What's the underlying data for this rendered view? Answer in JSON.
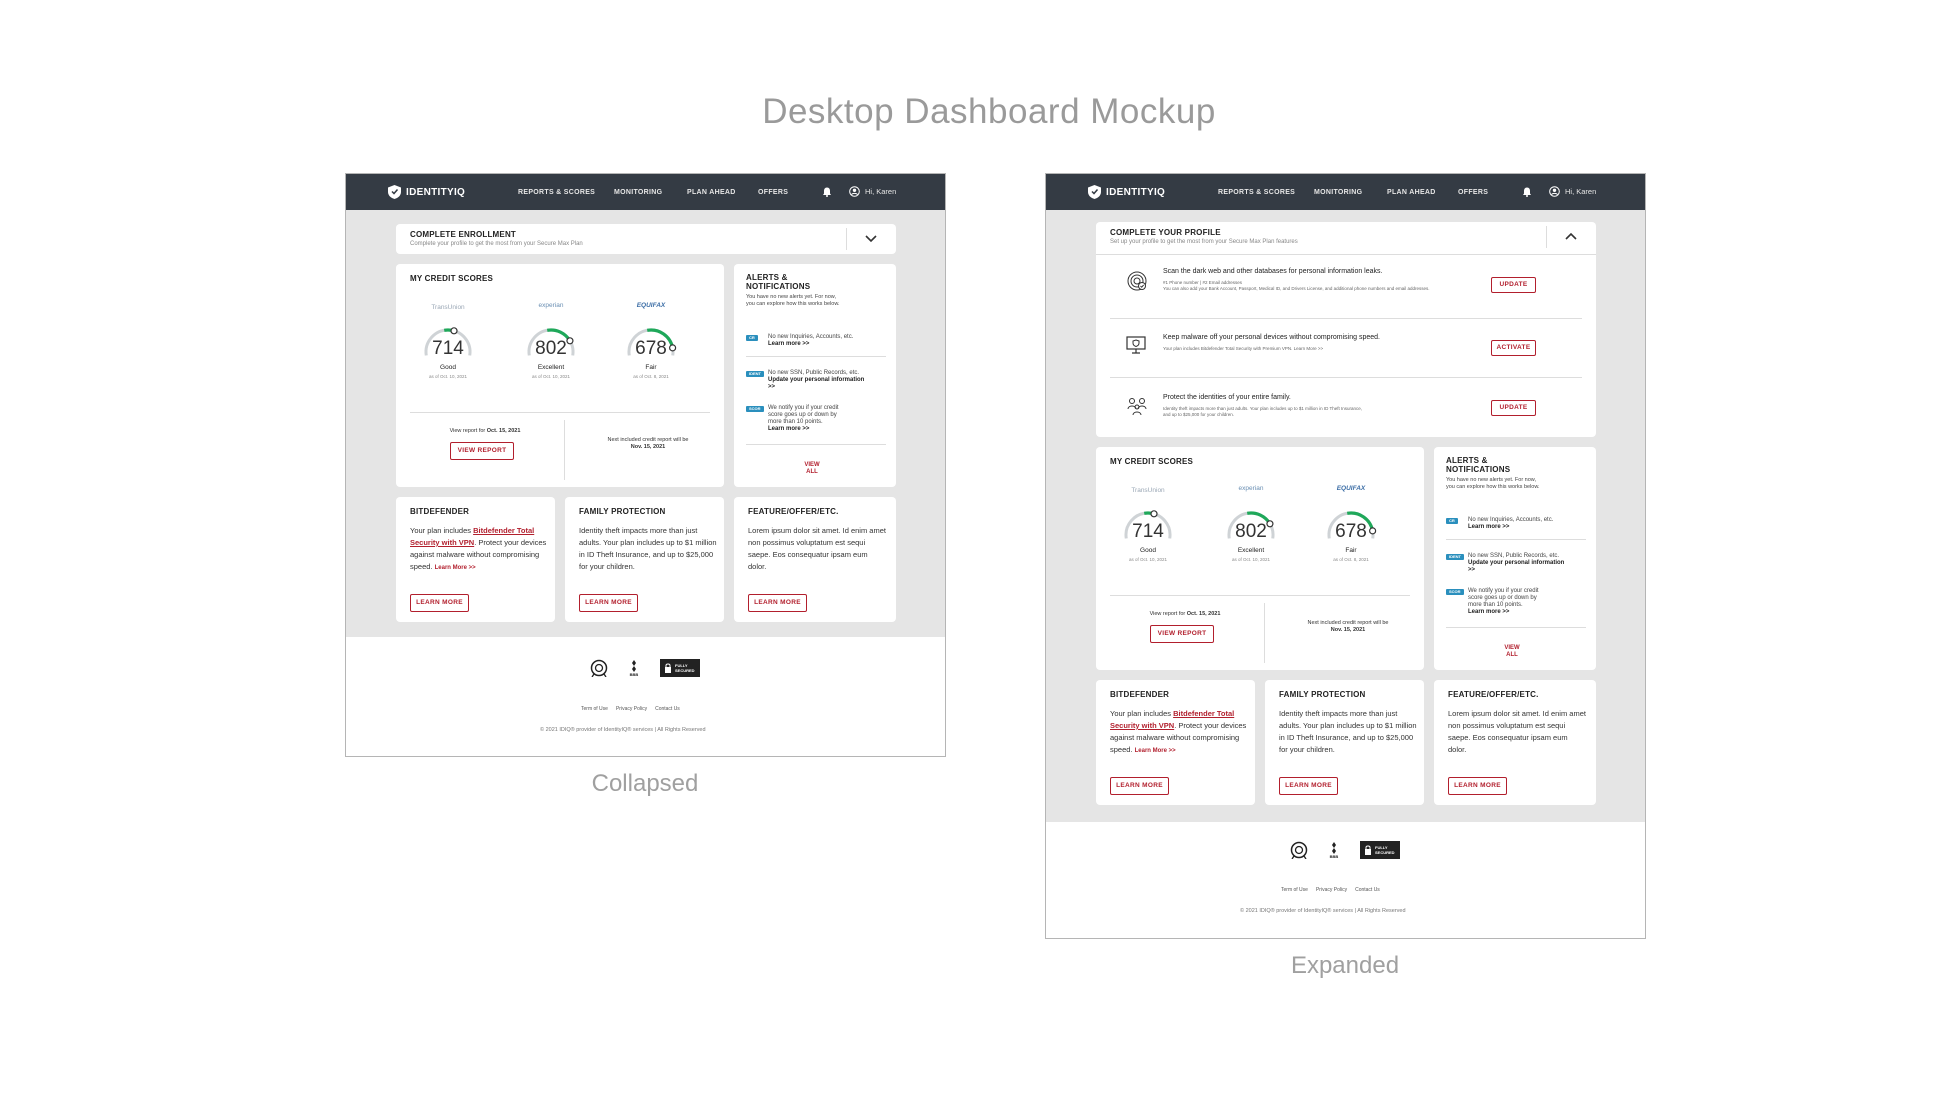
{
  "page_title": "Desktop Dashboard Mockup",
  "captions": {
    "collapsed": "Collapsed",
    "expanded": "Expanded"
  },
  "colors": {
    "nav_bg": "#343b44",
    "accent_red": "#b21f2d",
    "gauge_green": "#1fa85a",
    "tag_blue": "#2a8fbd",
    "page_gray": "#e5e5e5"
  },
  "nav": {
    "logo": "IDENTITYIQ",
    "items": [
      "REPORTS & SCORES",
      "MONITORING",
      "PLAN AHEAD",
      "OFFERS"
    ],
    "bell_icon": "bell-icon",
    "user_icon": "user-circle-icon",
    "greeting": "Hi, Karen"
  },
  "enrollment": {
    "title": "COMPLETE ENROLLMENT",
    "subtitle": "Complete your profile to get the most from your Secure Max Plan"
  },
  "profile": {
    "title": "COMPLETE YOUR PROFILE",
    "subtitle": "Set up your profile to get the most from your Secure Max Plan features",
    "rows": [
      {
        "icon": "fingerprint-icon",
        "main": "Scan the dark web and other databases for personal information leaks.",
        "desc": "#1 Phone number   |   #2 Email addresses",
        "desc2": "You can also add your Bank Account, Passport, Medical ID, and Drivers License, and additional phone numbers and email addresses.",
        "button": "UPDATE"
      },
      {
        "icon": "computer-shield-icon",
        "main": "Keep malware off your personal devices without compromising speed.",
        "desc": "Your plan includes Bitdefender Total Security with Premium VPN.  Learn More >>",
        "desc2": "",
        "button": "ACTIVATE"
      },
      {
        "icon": "family-icon",
        "main": "Protect the identities of your entire family.",
        "desc": "Identity theft impacts more than just adults. Your plan includes up to $1 million in ID Theft Insurance,",
        "desc2": "and up to $25,000 for your children.",
        "button": "UPDATE"
      }
    ]
  },
  "credit": {
    "title": "MY CREDIT SCORES",
    "bureaus": [
      {
        "name": "TransUnion",
        "score": "714",
        "rating": "Good",
        "as_of": "as of Oct. 10, 2021",
        "level": 0.58,
        "color": "#9aa7b5"
      },
      {
        "name": "experian",
        "score": "802",
        "rating": "Excellent",
        "as_of": "as of Oct. 10, 2021",
        "level": 0.8,
        "color": "#6a8fb3"
      },
      {
        "name": "EQUIFAX",
        "score": "678",
        "rating": "Fair",
        "as_of": "as of Oct. 8, 2021",
        "level": 0.9,
        "color": "#3c6ea6"
      }
    ],
    "view_report_text": "View report for",
    "view_report_date": "Oct. 15, 2021",
    "view_report_button": "VIEW REPORT",
    "next_report_text": "Next included credit report will be",
    "next_report_date": "Nov. 15, 2021"
  },
  "alerts": {
    "title": "ALERTS & NOTIFICATIONS",
    "intro": "You have no new alerts yet. For now, you can explore how this works below.",
    "items": [
      {
        "tag": "CR",
        "text": "No new Inquiries, Accounts, etc.",
        "link": "Learn more >>"
      },
      {
        "tag": "IDENT",
        "text": "No new SSN, Public Records, etc.",
        "link": "Update your personal information >>"
      },
      {
        "tag": "SCOR",
        "text": "We notify you if your credit score goes up or down by more than 10 points.",
        "link": "Learn more >>"
      }
    ],
    "view_all": "VIEW ALL"
  },
  "bottom_cards": [
    {
      "title": "BITDEFENDER",
      "pre": "Your plan includes ",
      "link": "Bitdefender Total Security with VPN",
      "post": ". Protect your devices against malware without compromising speed. ",
      "more": "Learn More >>",
      "button": "LEARN MORE"
    },
    {
      "title": "FAMILY PROTECTION",
      "text": "Identity theft impacts more than just adults. Your plan includes up to $1 million in ID Theft Insurance, and up to $25,000 for your children.",
      "button": "LEARN MORE"
    },
    {
      "title": "FEATURE/OFFER/ETC.",
      "text": "Lorem ipsum dolor sit amet. Id enim amet non possimus voluptatum est sequi saepe. Eos consequatur ipsam eum dolor.",
      "button": "LEARN MORE"
    }
  ],
  "footer": {
    "badges": [
      "cert-badge-icon",
      "bbb-icon",
      "fully-secured-icon"
    ],
    "bbb": "BBB",
    "secured": "FULLY SECURED",
    "links": [
      "Term of Use",
      "Privacy Policy",
      "Contact Us"
    ],
    "copyright": "© 2021 IDIQ® provider of IdentityIQ® services   |   All Rights Reserved"
  }
}
